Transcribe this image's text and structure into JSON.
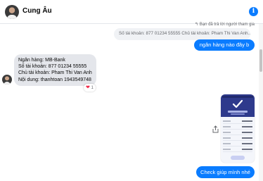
{
  "header": {
    "contact_name": "Cung Âu",
    "info_icon_glyph": "i"
  },
  "colors": {
    "accent": "#0a7cff",
    "incoming_bubble": "#e4e6eb",
    "heart": "#f02849"
  },
  "messages": {
    "reply_note": "Bạn đã trả lời người tham gia",
    "quoted_text": "Số tài khoản: 877 01234 55555 Chủ tài khoản: Pham Thi Van Anh...",
    "outgoing_1": "ngân hàng nào đây b",
    "incoming": {
      "line1": "Ngân hàng: MB-Bank",
      "line2": "Số tài khoản: 877 01234 55555",
      "line3": "Chủ tài khoản: Pham Thi Van Anh",
      "line4": "Nội dung: thanhtoan 1943549748"
    },
    "reaction_heart": "❤",
    "reaction_count": "1",
    "outgoing_last": "Check giúp mình nhé"
  },
  "icons": {
    "header_avatar": "avatar",
    "info": "info-icon",
    "reply": "reply-arrow-icon",
    "share": "share-icon",
    "transfer_success": "checkmark-icon"
  }
}
